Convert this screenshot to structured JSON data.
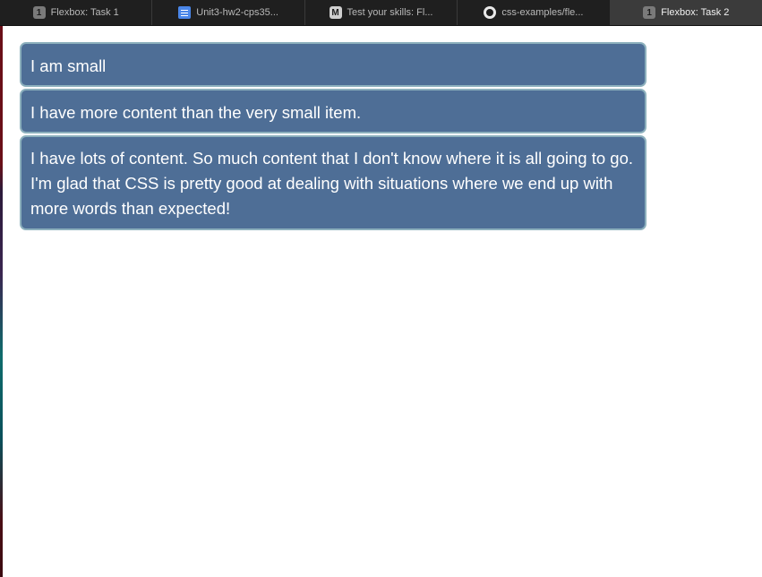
{
  "tabs": [
    {
      "label": "Flexbox: Task 1",
      "icon": "number-1-icon",
      "badge": "1",
      "active": false
    },
    {
      "label": "Unit3-hw2-cps35...",
      "icon": "google-docs-icon",
      "badge": "",
      "active": false
    },
    {
      "label": "Test your skills: Fl...",
      "icon": "mdn-icon",
      "badge": "M",
      "active": false
    },
    {
      "label": "css-examples/fle...",
      "icon": "github-icon",
      "badge": "",
      "active": false
    },
    {
      "label": "Flexbox: Task 2",
      "icon": "number-1-icon",
      "badge": "1",
      "active": true
    }
  ],
  "items": [
    "I am small",
    "I have more content than the very small item.",
    "I have lots of content. So much content that I don't know where it is all going to go. I'm glad that CSS is pretty good at dealing with situations where we end up with more words than expected!"
  ],
  "colors": {
    "item_background": "#4e6e96",
    "item_border": "#8cb0bd",
    "item_text": "#ffffff",
    "tabbar_background": "#1f1f1f",
    "active_tab_background": "#3b3b3b"
  }
}
